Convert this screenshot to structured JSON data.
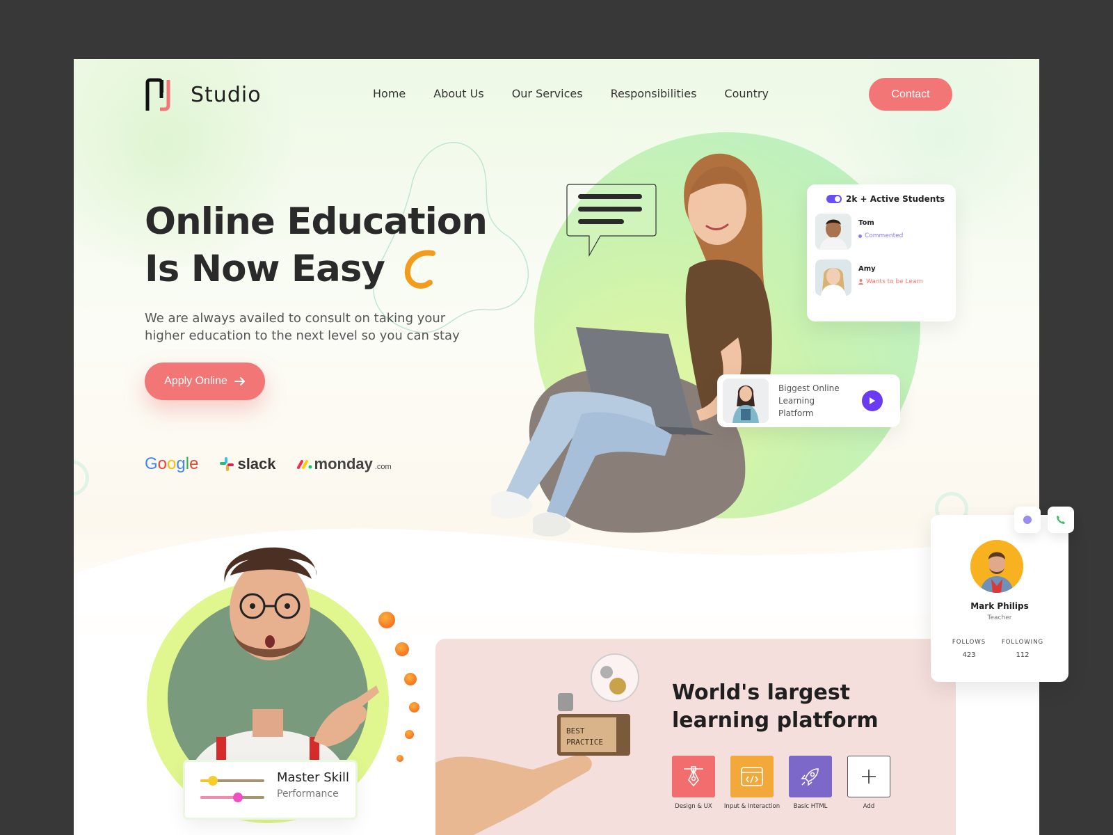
{
  "brand": {
    "name": "Studio",
    "accent": "#f27676",
    "purple": "#6a3cf0"
  },
  "nav": {
    "items": [
      "Home",
      "About Us",
      "Our Services",
      "Responsibilities",
      "Country"
    ],
    "contact_label": "Contact"
  },
  "hero": {
    "title_line1": "Online Education",
    "title_line2": "Is Now Easy",
    "description": "We are  always availed to consult on taking your higher education to the next level so you can stay",
    "apply_label": "Apply Online",
    "partners": {
      "google": "Google",
      "slack": "slack",
      "monday": "monday",
      "monday_suffix": ".com"
    }
  },
  "students_card": {
    "title": "2k + Active Students",
    "entries": [
      {
        "name": "Tom",
        "status": "Commented",
        "color": "#8a7cf5"
      },
      {
        "name": "Amy",
        "status": "Wants to be Learn",
        "color": "#f27676"
      }
    ]
  },
  "platform_card": {
    "text": "Biggest Online Learning Platform"
  },
  "skill_card": {
    "title": "Master Skill",
    "subtitle": "Performance"
  },
  "feature_panel": {
    "title": "World's largest learning platform",
    "tiles": [
      {
        "label": "Design & UX",
        "icon": "pen-tool-icon",
        "color": "#f26d6d"
      },
      {
        "label": "Input & Interaction",
        "icon": "code-window-icon",
        "color": "#f3a83a"
      },
      {
        "label": "Basic HTML",
        "icon": "rocket-icon",
        "color": "#7b68c8"
      },
      {
        "label": "Add",
        "icon": "plus-icon",
        "color": "#ffffff"
      }
    ]
  },
  "profile_card": {
    "name": "Mark Philips",
    "role": "Teacher",
    "follows_label": "FOLLOWS",
    "follows_value": "423",
    "following_label": "FOLLOWING",
    "following_value": "112"
  }
}
